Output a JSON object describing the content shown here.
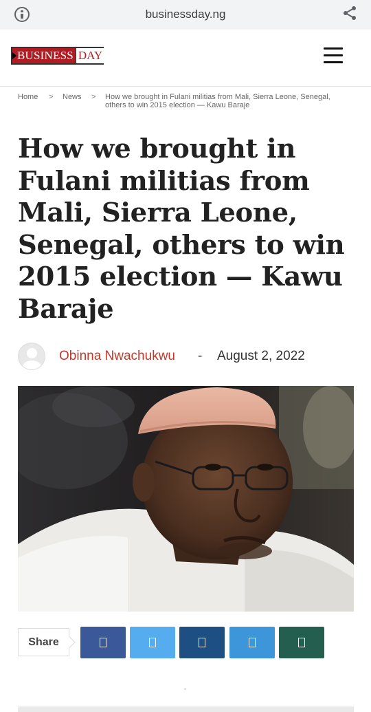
{
  "browser": {
    "url": "businessday.ng",
    "icons": {
      "info": "info-icon",
      "share": "share-icon"
    }
  },
  "site": {
    "logo_text_main": "BUSINESS",
    "logo_text_day": "DAY",
    "menu_icon": "hamburger-menu-icon",
    "brand_color": "#b01c22"
  },
  "breadcrumb": {
    "items": [
      "Home",
      "News"
    ],
    "separator": ">",
    "current": "How we brought in Fulani militias from Mali, Sierra Leone, Senegal, others to win 2015 election — Kawu Baraje"
  },
  "article": {
    "title": "How we brought in Fulani militias from Mali, Sierra Leone, Senegal, others to win 2015 election — Kawu Baraje",
    "author": "Obinna Nwachukwu",
    "separator": "-",
    "date": "August 2, 2022",
    "author_color": "#c0392b"
  },
  "share": {
    "label": "Share",
    "buttons": [
      {
        "name": "facebook",
        "icon": "facebook-icon",
        "color": "#3b5998"
      },
      {
        "name": "twitter",
        "icon": "twitter-icon",
        "color": "#55acee"
      },
      {
        "name": "linkedin",
        "icon": "linkedin-icon",
        "color": "#1e4f82"
      },
      {
        "name": "telegram",
        "icon": "telegram-icon",
        "color": "#3d96d9"
      },
      {
        "name": "whatsapp",
        "icon": "whatsapp-icon",
        "color": "#245e4f"
      }
    ]
  }
}
